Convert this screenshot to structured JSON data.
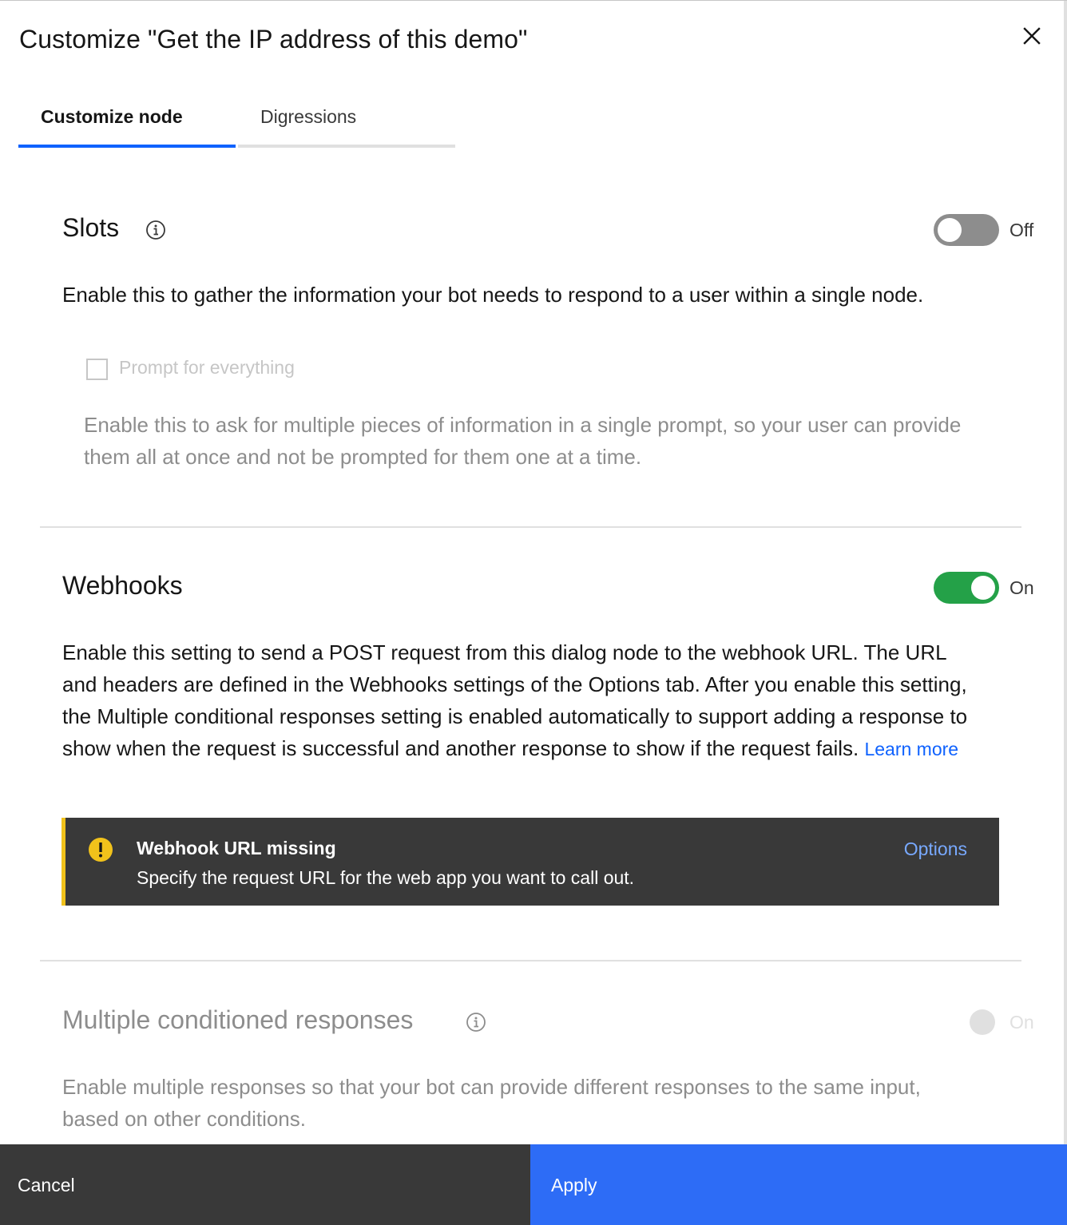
{
  "header": {
    "title": "Customize \"Get the IP address of this demo\"",
    "close_icon": "close-icon"
  },
  "tabs": [
    {
      "label": "Customize node",
      "active": true
    },
    {
      "label": "Digressions",
      "active": false
    }
  ],
  "slots": {
    "title": "Slots",
    "info_icon": "info-icon",
    "toggle_state": "Off",
    "description": "Enable this to gather the information your bot needs to respond to a user within a single node.",
    "prompt_checkbox_label": "Prompt for everything",
    "prompt_checked": false,
    "prompt_description": "Enable this to ask for multiple pieces of information in a single prompt, so your user can provide them all at once and not be prompted for them one at a time."
  },
  "webhooks": {
    "title": "Webhooks",
    "toggle_state": "On",
    "description": "Enable this setting to send a POST request from this dialog node to the webhook URL. The URL and headers are defined in the Webhooks settings of the Options tab. After you enable this setting, the Multiple conditional responses setting is enabled automatically to support adding a response to show when the request is successful and another response to show if the request fails.",
    "learn_more": "Learn more",
    "notification": {
      "icon": "warning-icon",
      "title": "Webhook URL missing",
      "subtitle": "Specify the request URL for the web app you want to call out.",
      "action": "Options"
    }
  },
  "mcr": {
    "title": "Multiple conditioned responses",
    "info_icon": "info-icon",
    "toggle_state": "On",
    "description": "Enable multiple responses so that your bot can provide different responses to the same input, based on other conditions."
  },
  "footer": {
    "cancel_label": "Cancel",
    "apply_label": "Apply"
  },
  "colors": {
    "accent": "#0f62fe",
    "toggle_on": "#24a148",
    "warning": "#f1c21b",
    "apply_bg": "#2d6cf6",
    "dark_bg": "#393939"
  }
}
